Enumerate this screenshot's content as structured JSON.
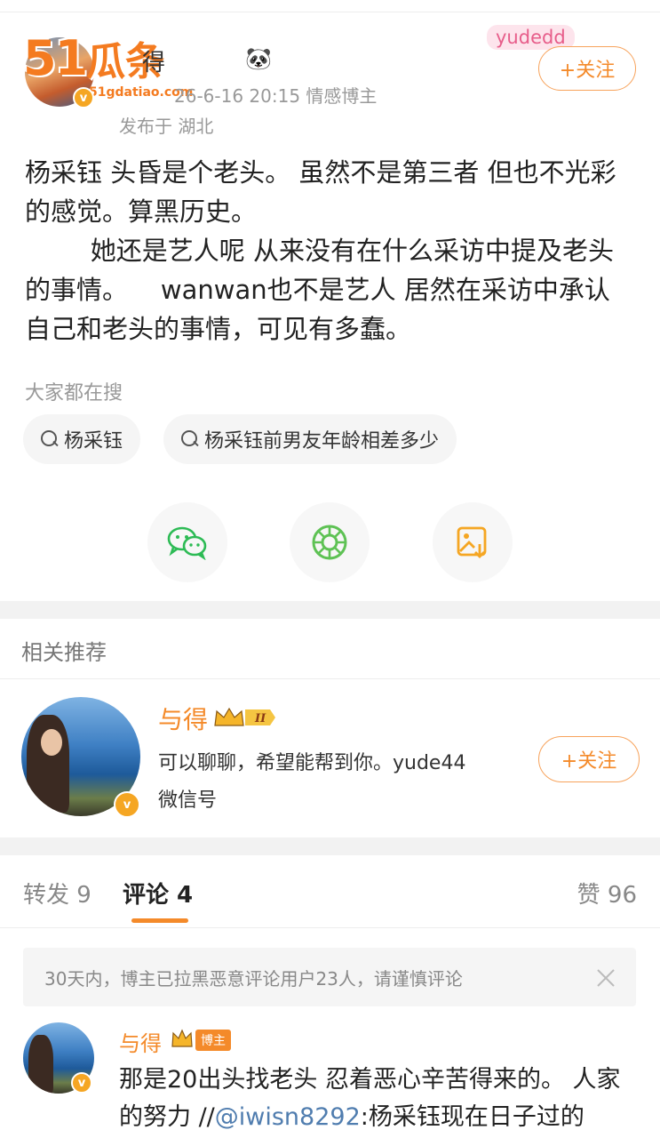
{
  "header": {
    "author_name": "得",
    "meta": "26-6-16 20:15  情感博主",
    "location": "发布于 湖北",
    "top_tag": "yudedd",
    "follow_label": "+关注",
    "watermark": {
      "brand": "51",
      "brand_zh": "瓜条",
      "url": "51gdatiao.com"
    }
  },
  "post": {
    "line1": "杨采钰 头昏是个老头。 虽然不是第三者 但也不光彩",
    "line2": "的感觉。算黑历史。",
    "line3": "        她还是艺人呢 从来没有在什么采访中提及老头",
    "line4": "的事情。    wanwan也不是艺人 居然在采访中承认",
    "line5": "自己和老头的事情，可见有多蠢。"
  },
  "search": {
    "label": "大家都在搜",
    "chips": [
      "杨采钰",
      "杨采钰前男友年龄相差多少"
    ]
  },
  "share": {
    "icons": [
      "wechat-icon",
      "moments-icon",
      "save-image-icon"
    ]
  },
  "recommend": {
    "title": "相关推荐",
    "name": "与得",
    "level": "II",
    "desc": "可以聊聊，希望能帮到你。yude44",
    "desc2": "微信号",
    "follow_label": "+关注"
  },
  "tabs": {
    "repost": "转发 9",
    "comment": "评论 4",
    "like": "赞 96"
  },
  "notice": "30天内，博主已拉黑恶意评论用户23人，请谨慎评论",
  "comment": {
    "name": "与得",
    "tag": "博主",
    "text_before": "那是20出头找老头 忍着恶心辛苦得来的。 人家的努力 //",
    "mention": "@iwisn8292",
    "text_after": ":杨采钰现在日子过的"
  },
  "colors": {
    "accent": "#f48a2a",
    "link": "#507daf",
    "gray": "#999999"
  }
}
